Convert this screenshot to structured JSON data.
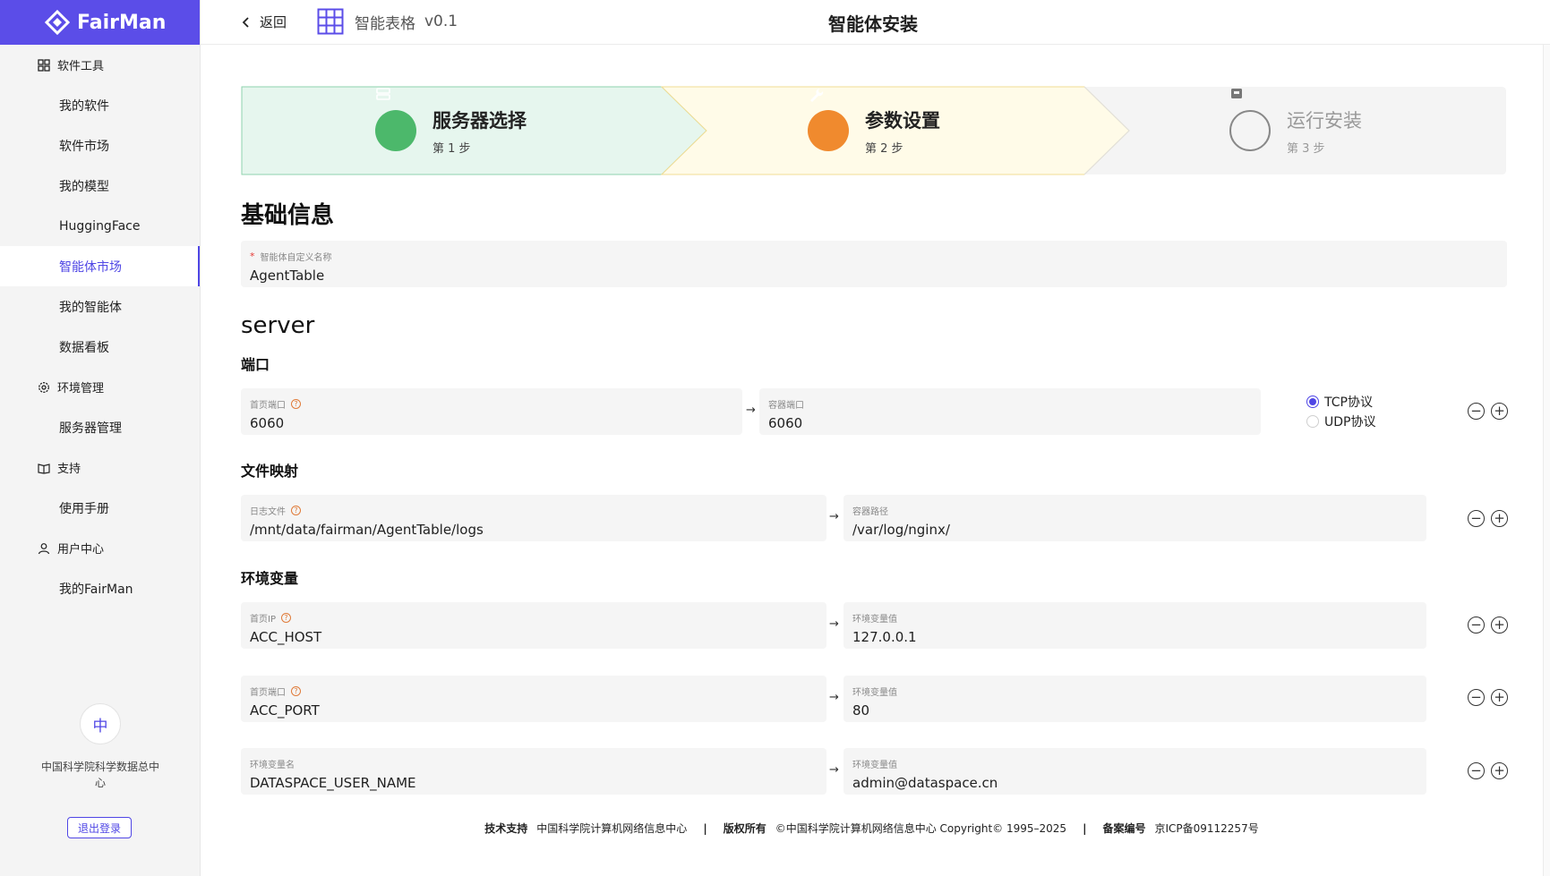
{
  "brand": {
    "name": "FairMan"
  },
  "sidebar": {
    "groups": [
      {
        "label": "软件工具",
        "icon": "grid-icon",
        "items": [
          "我的软件",
          "软件市场",
          "我的模型",
          "HuggingFace",
          "智能体市场",
          "我的智能体",
          "数据看板"
        ]
      },
      {
        "label": "环境管理",
        "icon": "gear-icon",
        "items": [
          "服务器管理"
        ]
      },
      {
        "label": "支持",
        "icon": "book-icon",
        "items": [
          "使用手册"
        ]
      },
      {
        "label": "用户中心",
        "icon": "user-icon",
        "items": [
          "我的FairMan"
        ]
      }
    ],
    "active_item": "智能体市场",
    "org_avatar": "中",
    "org_name": "中国科学院科学数据总中心",
    "logout_label": "退出登录"
  },
  "header": {
    "back_label": "返回",
    "app_name": "智能表格",
    "app_version": "v0.1",
    "page_title": "智能体安装"
  },
  "steps": [
    {
      "title": "服务器选择",
      "sub": "第 1 步",
      "state": "done",
      "color": "#4cb86b"
    },
    {
      "title": "参数设置",
      "sub": "第 2 步",
      "state": "active",
      "color": "#f08a2e"
    },
    {
      "title": "运行安装",
      "sub": "第 3 步",
      "state": "pending",
      "color": "#999999"
    }
  ],
  "form": {
    "basic_title": "基础信息",
    "name_label": "智能体自定义名称",
    "name_required": "*",
    "name_value": "AgentTable",
    "server_title": "server",
    "port_title": "端口",
    "port": {
      "host_label": "首页端口",
      "host_value": "6060",
      "container_label": "容器端口",
      "container_value": "6060"
    },
    "protocols": [
      {
        "label": "TCP协议",
        "checked": true
      },
      {
        "label": "UDP协议",
        "checked": false
      }
    ],
    "mapping_title": "文件映射",
    "mapping": {
      "host_label": "日志文件",
      "host_value": "/mnt/data/fairman/AgentTable/logs",
      "container_label": "容器路径",
      "container_value": "/var/log/nginx/"
    },
    "env_title": "环境变量",
    "env": [
      {
        "name_label": "首页IP",
        "name_value": "ACC_HOST",
        "value_label": "环境变量值",
        "value": "127.0.0.1",
        "help": true
      },
      {
        "name_label": "首页端口",
        "name_value": "ACC_PORT",
        "value_label": "环境变量值",
        "value": "80",
        "help": true
      },
      {
        "name_label": "环境变量名",
        "name_value": "DATASPACE_USER_NAME",
        "value_label": "环境变量值",
        "value": "admin@dataspace.cn",
        "help": false
      }
    ],
    "arrow": "→",
    "minus": "−",
    "plus": "+",
    "help_glyph": "?"
  },
  "footer": {
    "tech_label": "技术支持",
    "tech_value": "中国科学院计算机网络信息中心",
    "copy_label": "版权所有",
    "copy_value": "©中国科学院计算机网络信息中心 Copyright© 1995–2025",
    "icp_label": "备案编号",
    "icp_value": "京ICP备09112257号",
    "separator": "|"
  },
  "colors": {
    "accent": "#4f46e5",
    "brand_bar": "#5b4de8",
    "step_done_bg": "#e6f6ee",
    "step_active_bg": "#fffbe8",
    "step_pending_bg": "#f4f4f4"
  }
}
